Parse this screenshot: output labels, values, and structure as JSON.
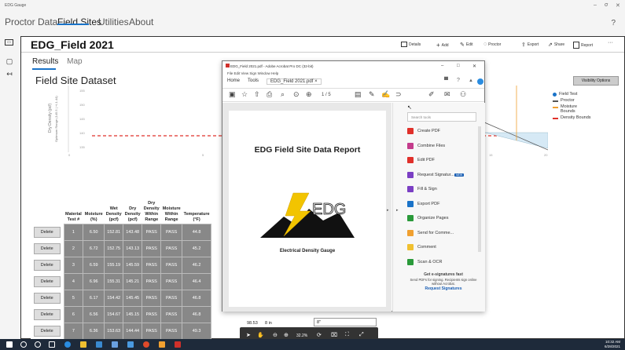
{
  "window": {
    "title": "EDG Gauge",
    "controls": [
      "–",
      "σ",
      "✕"
    ]
  },
  "nav": {
    "items": [
      "Proctor Data",
      "Field Sites",
      "Utilities",
      "About"
    ],
    "active": "Field Sites",
    "help": "?"
  },
  "header": {
    "title": "EDG_Field 2021",
    "toolbar": {
      "details": "Details",
      "add": "Add",
      "edit": "Edit",
      "proctor": "Proctor",
      "export": "Export",
      "share": "Share",
      "report": "Report",
      "more": "···"
    }
  },
  "tabs": {
    "results": "Results",
    "map": "Map"
  },
  "dataset_title": "Field Site Dataset",
  "visibility_options": "Visibility Options",
  "legend": [
    {
      "label": "Field Test",
      "color": "#1a73c8",
      "kind": "dot"
    },
    {
      "label": "Proctor",
      "color": "#555555",
      "kind": "line"
    },
    {
      "label": "Moisture Bounds",
      "color": "#f0a030",
      "kind": "line"
    },
    {
      "label": "Density Bounds",
      "color": "#e0302a",
      "kind": "line"
    }
  ],
  "chart_data": {
    "type": "line",
    "ylabel": "Dry Density (pcf)",
    "ylabel2": "Optimum Range (145.5 | +/-1.44)",
    "y_ticks": [
      "155",
      "150",
      "145",
      "140",
      "135"
    ],
    "x_ticks": [
      "0",
      "5",
      "15",
      "20"
    ],
    "series": [
      {
        "name": "Density Bounds",
        "style": "dashed",
        "color": "#e0302a",
        "x": [
          0,
          20
        ],
        "y": [
          140,
          140
        ]
      }
    ]
  },
  "table": {
    "columns": [
      "",
      "Material Test #",
      "Moisture (%)",
      "Wet Density (pcf)",
      "Dry Density (pcf)",
      "Dry Density Within Range",
      "Moisture Within Range",
      "Temperature (°F)"
    ],
    "delete_label": "Delete",
    "rows": [
      [
        "1",
        "6.50",
        "152.81",
        "143.48",
        "PASS",
        "PASS",
        "44.8"
      ],
      [
        "2",
        "6.72",
        "152.75",
        "143.13",
        "PASS",
        "PASS",
        "45.2"
      ],
      [
        "3",
        "6.59",
        "155.19",
        "145.59",
        "PASS",
        "PASS",
        "46.2"
      ],
      [
        "4",
        "6.96",
        "155.31",
        "145.21",
        "PASS",
        "PASS",
        "46.4"
      ],
      [
        "5",
        "6.17",
        "154.42",
        "145.45",
        "PASS",
        "PASS",
        "46.8"
      ],
      [
        "6",
        "6.56",
        "154.67",
        "145.15",
        "PASS",
        "PASS",
        "46.8"
      ],
      [
        "7",
        "6.36",
        "153.63",
        "144.44",
        "PASS",
        "PASS",
        "49.3"
      ]
    ],
    "last_row_tail": {
      "value": "98.53",
      "depth": "8 in",
      "note": "8\""
    }
  },
  "acrobat": {
    "title": "EDG_Field 2021.pdf - Adobe Acrobat Pro DC (32-bit)",
    "menu": "File  Edit  View  Sign  Window  Help",
    "tabs": [
      "Home",
      "Tools",
      "EDG_Field 2021.pdf ×"
    ],
    "page_indicator": "1 / 5",
    "zoom": "32.2%",
    "report_title": "EDG Field Site Data Report",
    "logo_text": "EDG",
    "logo_caption": "Electrical Density Gauge",
    "search_placeholder": "Search tools",
    "tools": [
      {
        "label": "Create PDF",
        "color": "#e0302a"
      },
      {
        "label": "Combine Files",
        "color": "#c43c8c"
      },
      {
        "label": "Edit PDF",
        "color": "#e0302a"
      },
      {
        "label": "Request Signatur...",
        "color": "#7b3fc4"
      },
      {
        "label": "Fill & Sign",
        "color": "#7b3fc4"
      },
      {
        "label": "Export PDF",
        "color": "#1a73c8"
      },
      {
        "label": "Organize Pages",
        "color": "#2a9a3a"
      },
      {
        "label": "Send for Comme...",
        "color": "#f0a030"
      },
      {
        "label": "Comment",
        "color": "#f0c030"
      },
      {
        "label": "Scan & OCR",
        "color": "#2a9a3a"
      }
    ],
    "new_badge": "NEW",
    "promo": {
      "title": "Get e-signatures fast",
      "text": "Send PDFs for signing. Recipients sign online without Acrobat.",
      "link": "Request Signatures"
    }
  },
  "taskbar": {
    "time": "10:32 AM",
    "date": "6/28/2021"
  }
}
